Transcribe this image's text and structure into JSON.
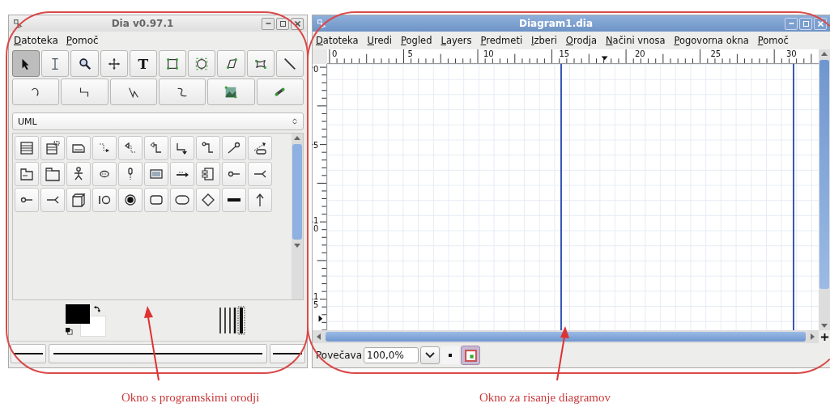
{
  "toolbox_window": {
    "title": "Dia v0.97.1",
    "menu": [
      "Datoteka",
      "Pomoč"
    ],
    "tools": [
      {
        "selected": true
      },
      {
        "selected": false
      },
      {
        "selected": false
      },
      {
        "selected": false
      },
      {
        "selected": false,
        "label": "T"
      },
      {
        "selected": false
      },
      {
        "selected": false
      },
      {
        "selected": false
      },
      {
        "selected": false
      },
      {
        "selected": false
      }
    ],
    "tools_row_2": [
      {
        "selected": false
      },
      {
        "selected": false
      },
      {
        "selected": false
      },
      {
        "selected": false
      },
      {
        "selected": false
      },
      {
        "selected": false
      }
    ],
    "sheet_selector": {
      "value": "UML"
    }
  },
  "diagram_window": {
    "title": "Diagram1.dia",
    "menu": [
      "Datoteka",
      "Uredi",
      "Pogled",
      "Layers",
      "Predmeti",
      "Izberi",
      "Orodja",
      "Načini vnosa",
      "Pogovorna okna",
      "Pomoč"
    ],
    "horizontal_ruler": [
      "0",
      "5",
      "10",
      "15",
      "20",
      "25",
      "30"
    ],
    "vertical_ruler": [
      "0",
      "5",
      "1\n0",
      "1\n5"
    ],
    "zoom_label": "Povečava",
    "zoom_field": {
      "value": "100,0%"
    }
  },
  "annotations": [
    {
      "caption": "Okno s programskimi orodji"
    },
    {
      "caption": "Okno za risanje diagramov"
    }
  ]
}
